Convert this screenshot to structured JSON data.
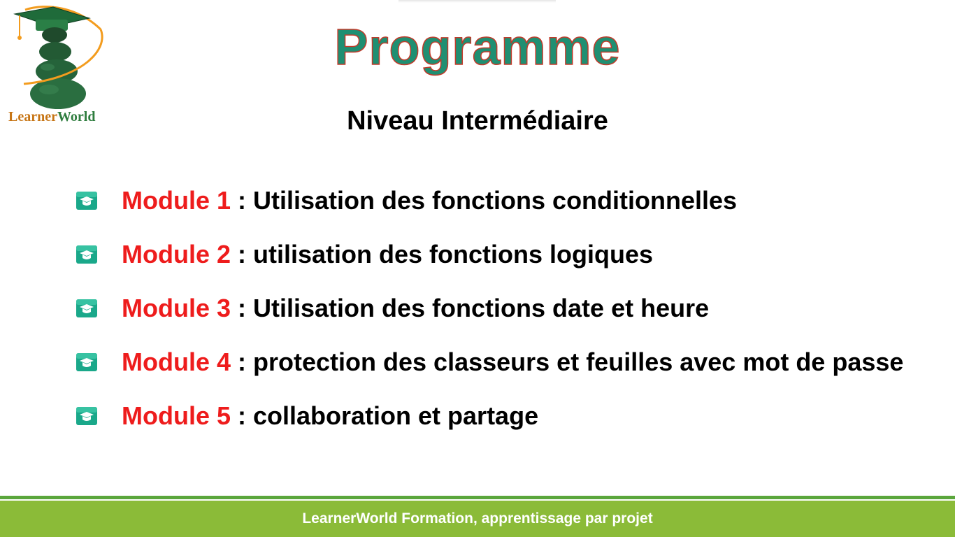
{
  "logo": {
    "text_part1": "Learner",
    "text_part2": "World",
    "icon": "stacked-stones-graduation-cap-logo"
  },
  "title": "Programme",
  "subtitle": "Niveau Intermédiaire",
  "modules": [
    {
      "label": "Module 1",
      "separator": " : ",
      "description": "Utilisation des fonctions conditionnelles"
    },
    {
      "label": "Module 2",
      "separator": " : ",
      "description": "utilisation des fonctions logiques"
    },
    {
      "label": "Module 3",
      "separator": " : ",
      "description": "Utilisation des fonctions date et heure"
    },
    {
      "label": "Module 4",
      "separator": " : ",
      "description": "protection des classeurs et feuilles avec mot de passe"
    },
    {
      "label": "Module 5",
      "separator": " : ",
      "description": "collaboration et partage"
    }
  ],
  "bullet_icon": "graduation-cap-icon",
  "footer": {
    "text": "LearnerWorld Formation, apprentissage par projet"
  },
  "colors": {
    "title_fill": "#1f8f72",
    "title_outline": "#c23a2a",
    "module_label": "#ee1c1c",
    "footer_bg": "#8bbb38",
    "footer_line": "#5aa63c",
    "bullet": "#1aa88a"
  }
}
